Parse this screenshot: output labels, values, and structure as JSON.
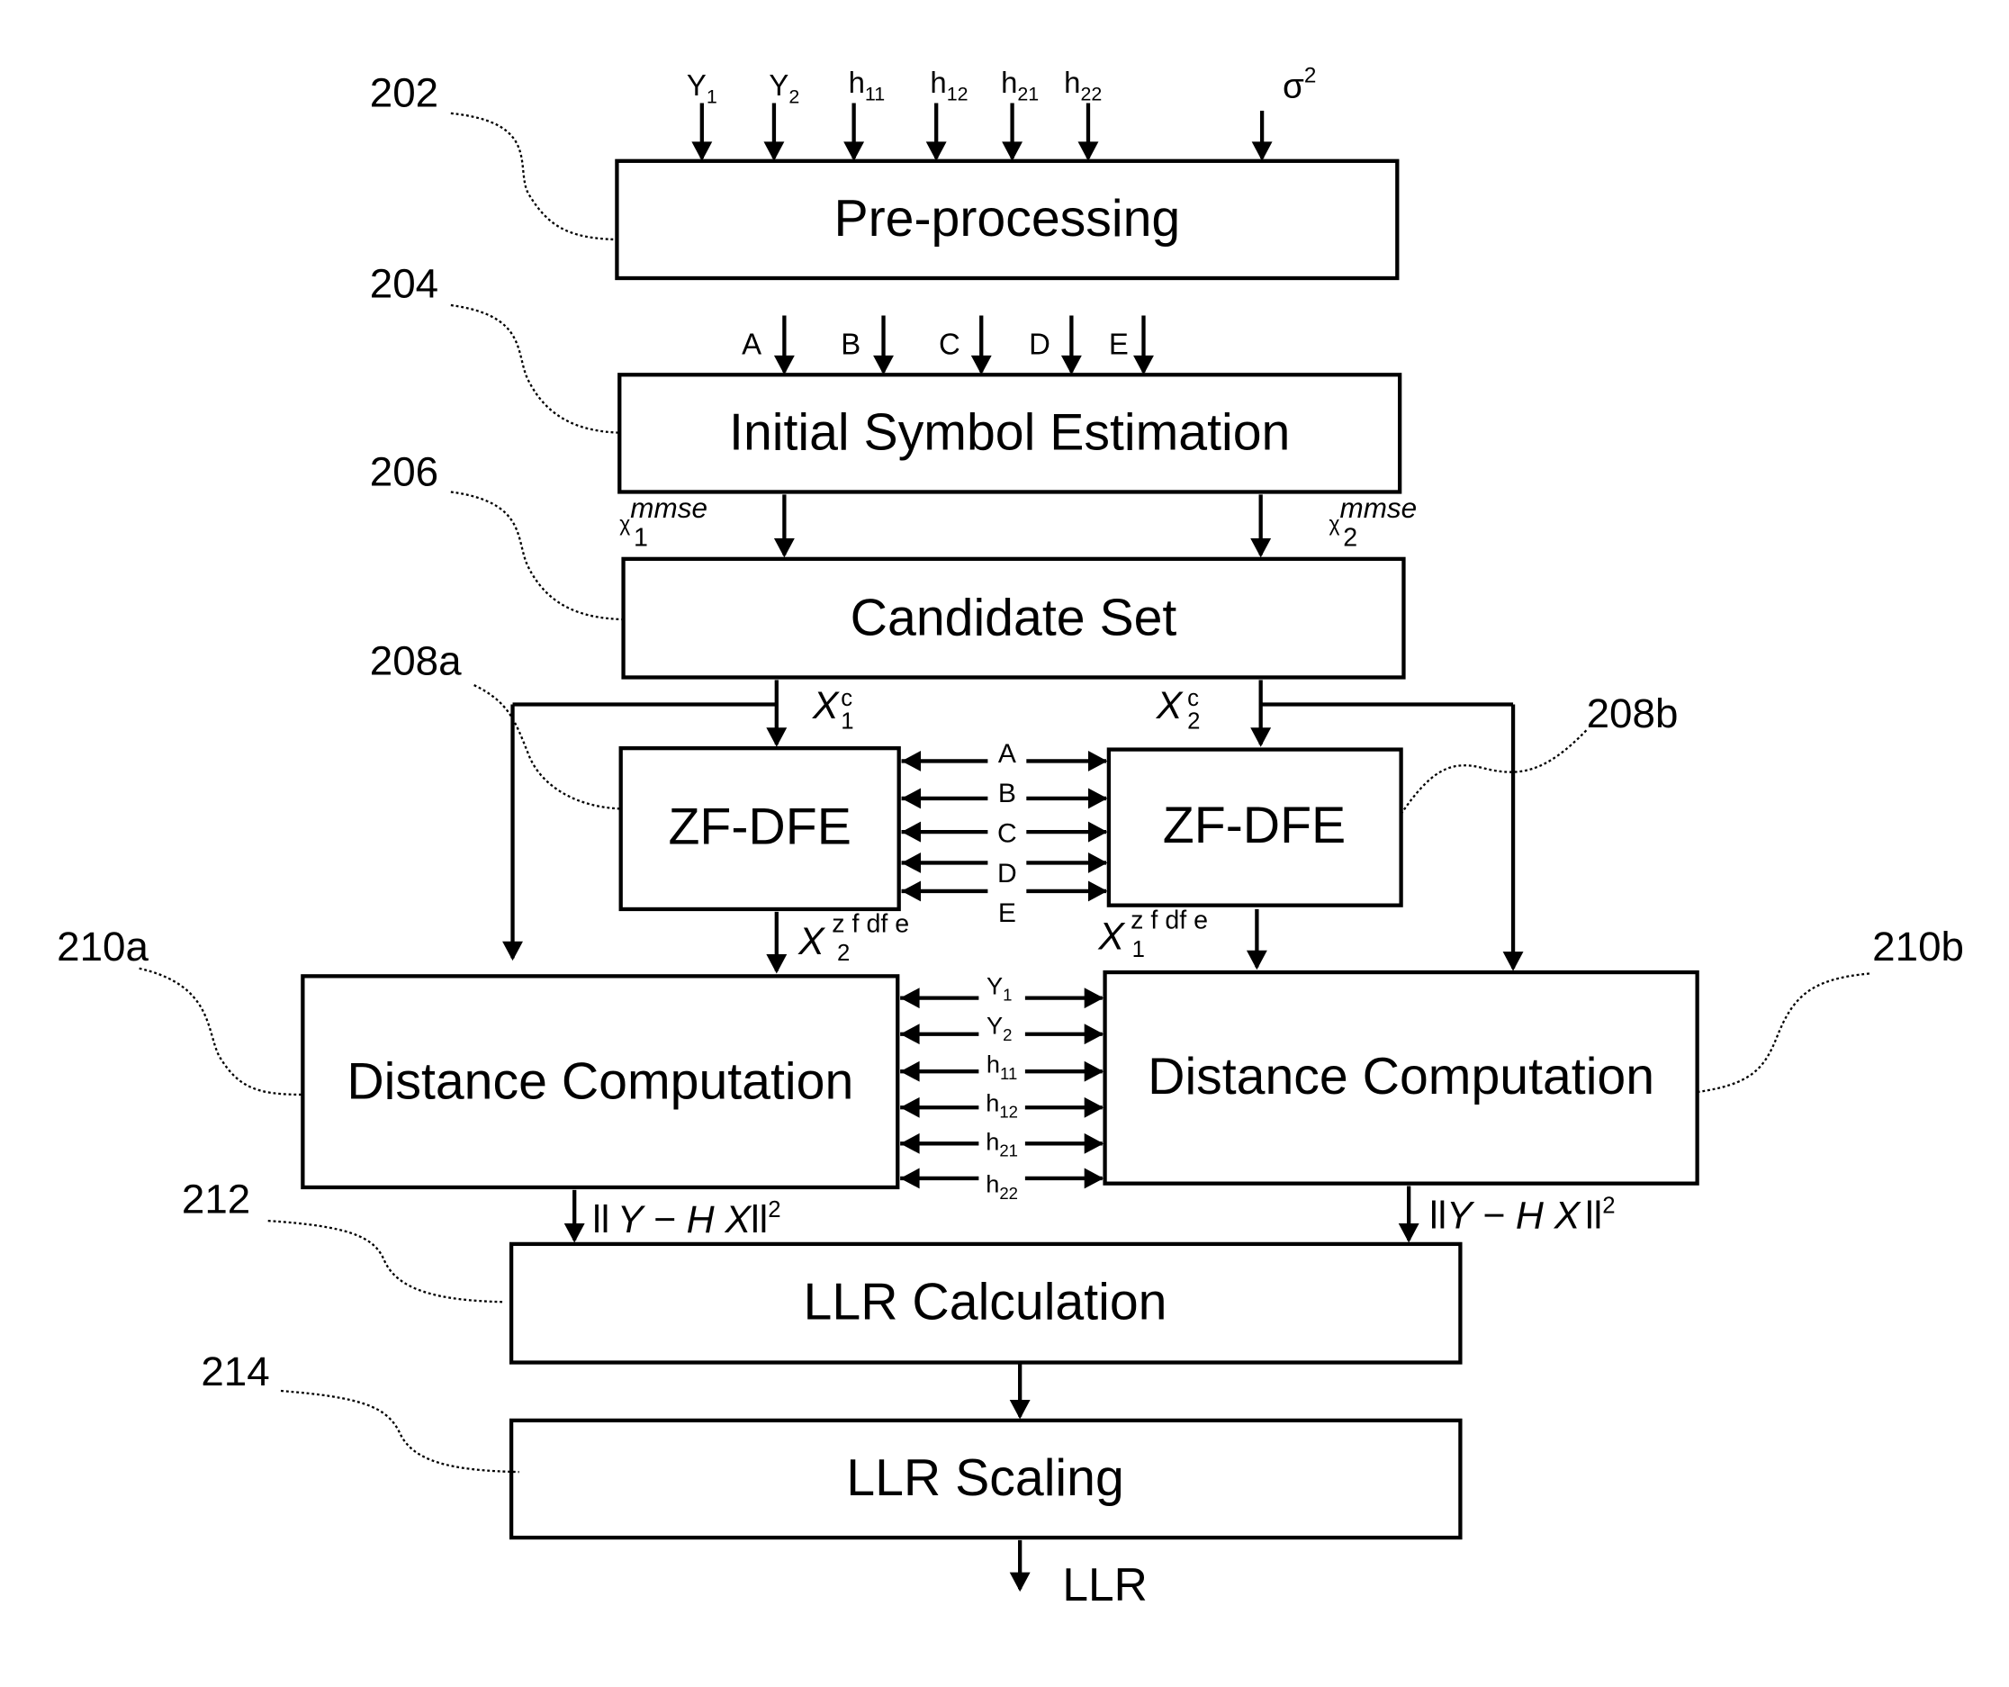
{
  "diagram": {
    "blocks": {
      "preprocessing": {
        "label": "Pre-processing",
        "ref": "202"
      },
      "initial_symbol": {
        "label": "Initial Symbol Estimation",
        "ref": "204"
      },
      "candidate_set": {
        "label": "Candidate Set",
        "ref": "206"
      },
      "zfdfe_a": {
        "label": "ZF-DFE",
        "ref": "208a"
      },
      "zfdfe_b": {
        "label": "ZF-DFE",
        "ref": "208b"
      },
      "distance_a": {
        "label": "Distance Computation",
        "ref": "210a"
      },
      "distance_b": {
        "label": "Distance Computation",
        "ref": "210b"
      },
      "llr_calc": {
        "label": "LLR Calculation",
        "ref": "212"
      },
      "llr_scaling": {
        "label": "LLR Scaling",
        "ref": "214"
      }
    },
    "preprocessing_inputs": [
      {
        "base": "Y",
        "sub": "1"
      },
      {
        "base": "Y",
        "sub": "2"
      },
      {
        "base": "h",
        "sub": "11"
      },
      {
        "base": "h",
        "sub": "12"
      },
      {
        "base": "h",
        "sub": "21"
      },
      {
        "base": "h",
        "sub": "22"
      }
    ],
    "noise_input": {
      "base": "σ",
      "sup": "2"
    },
    "intermediate_signals": [
      "A",
      "B",
      "C",
      "D",
      "E"
    ],
    "mmse_outputs": [
      {
        "base": "χ",
        "sub": "1",
        "sup": "mmse"
      },
      {
        "base": "χ",
        "sub": "2",
        "sup": "mmse"
      }
    ],
    "candidate_outputs": [
      {
        "base": "X",
        "sub": "1",
        "sup": "c"
      },
      {
        "base": "X",
        "sub": "2",
        "sup": "c"
      }
    ],
    "zfdfe_outputs": [
      {
        "base": "X",
        "sub": "2",
        "sup": "z f df e"
      },
      {
        "base": "X",
        "sub": "1",
        "sup": "z f df e"
      }
    ],
    "distance_shared": [
      {
        "base": "Y",
        "sub": "1"
      },
      {
        "base": "Y",
        "sub": "2"
      },
      {
        "base": "h",
        "sub": "11"
      },
      {
        "base": "h",
        "sub": "12"
      },
      {
        "base": "h",
        "sub": "21"
      },
      {
        "base": "h",
        "sub": "22"
      }
    ],
    "distance_metric": {
      "open": "ll",
      "expr": "Y − H X",
      "close": "ll",
      "sup": "2"
    },
    "final_output": "LLR"
  }
}
